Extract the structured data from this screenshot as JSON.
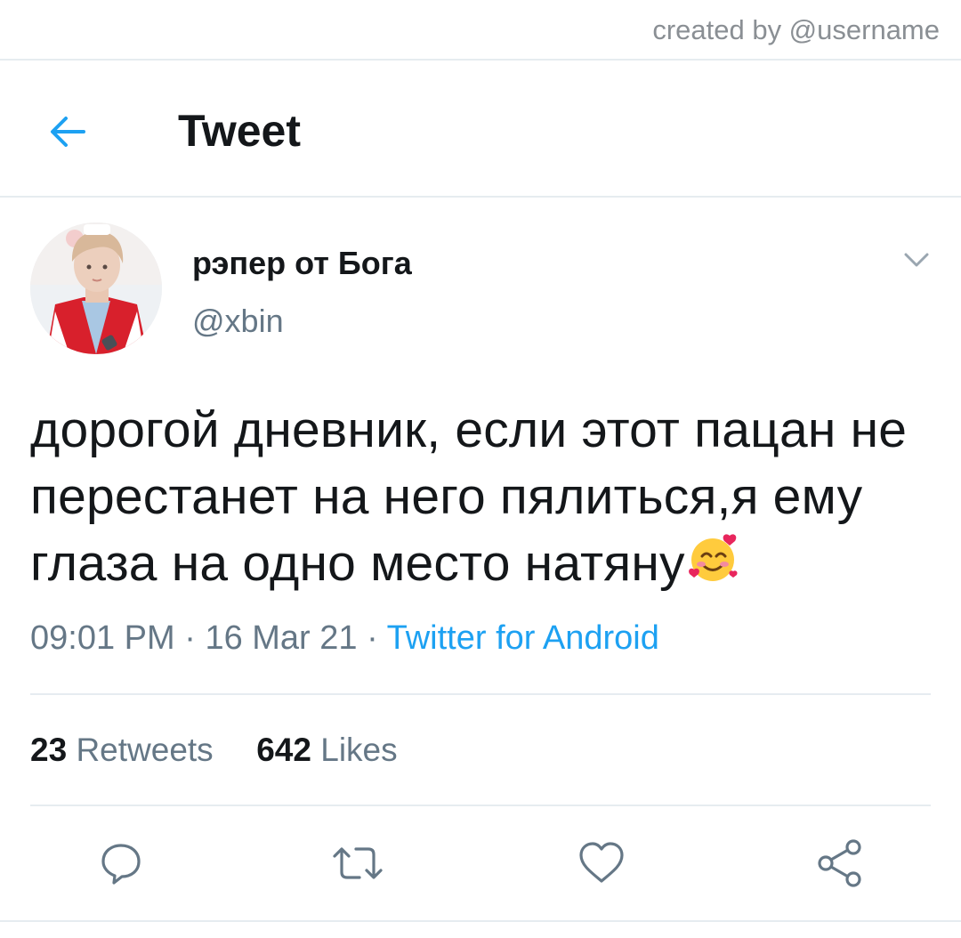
{
  "watermark": "created by @username",
  "header": {
    "title": "Tweet"
  },
  "tweet": {
    "display_name": "рэпер от Бога",
    "handle": "@xbin",
    "text": "дорогой дневник, если этот пацан не перестанет на него пялиться,я ему глаза на одно место натяну",
    "time": "09:01 PM",
    "date": "16 Mar 21",
    "source": "Twitter for Android",
    "retweets": "23",
    "retweets_label": "Retweets",
    "likes": "642",
    "likes_label": "Likes"
  },
  "icons": {
    "back": "arrow-left-icon",
    "caret": "chevron-down-icon",
    "emoji": "smiling-face-with-hearts",
    "reply": "speech-bubble-icon",
    "retweet": "retweet-icon",
    "like": "heart-icon",
    "share": "share-icon"
  },
  "colors": {
    "accent": "#1da1f2",
    "text": "#14171a",
    "secondary": "#657786",
    "divider": "#e6ecf0"
  }
}
